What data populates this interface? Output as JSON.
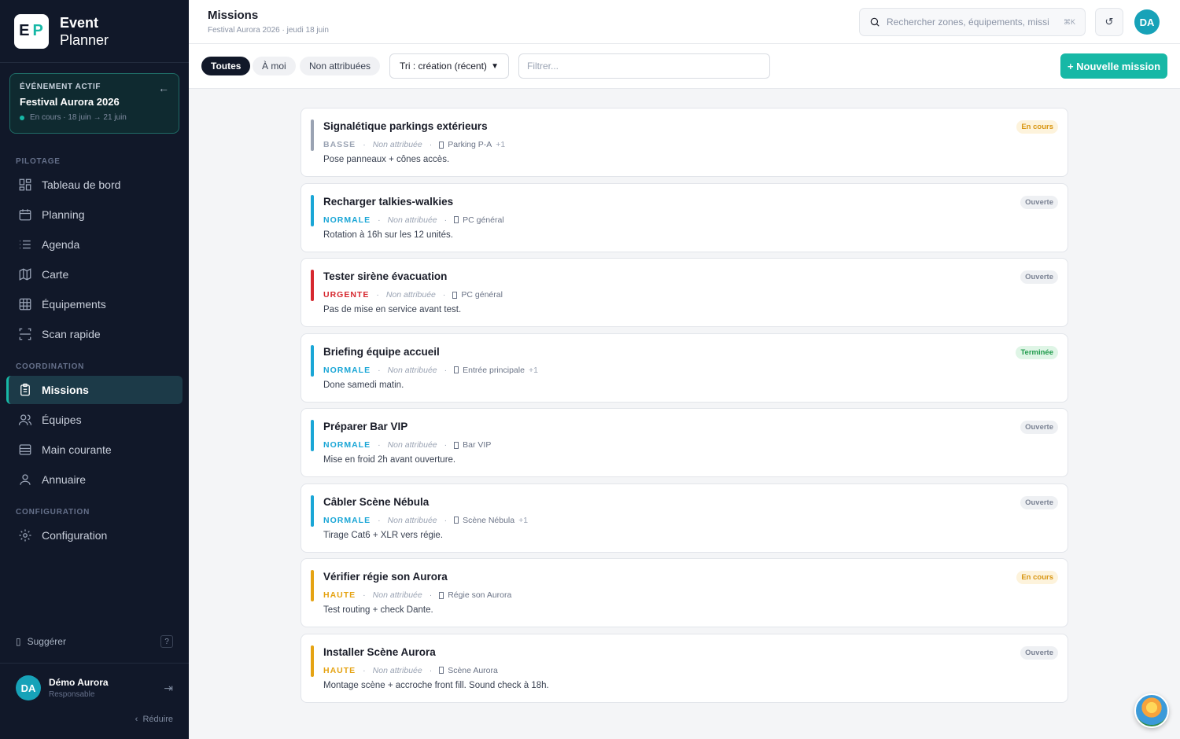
{
  "brand": {
    "initial_e": "E",
    "initial_p": "P",
    "line1": "Event",
    "line2": "Planner"
  },
  "event": {
    "label": "ÉVÉNEMENT ACTIF",
    "name": "Festival Aurora 2026",
    "status": "En cours",
    "dates": "· 18 juin → 21 juin",
    "back_icon": "arrow-left-icon"
  },
  "nav": {
    "section_pilotage": "PILOTAGE",
    "section_coordination": "COORDINATION",
    "section_configuration": "CONFIGURATION",
    "items": [
      {
        "label": "Tableau de bord",
        "icon": "dashboard-icon"
      },
      {
        "label": "Planning",
        "icon": "calendar-icon"
      },
      {
        "label": "Agenda",
        "icon": "list-icon"
      },
      {
        "label": "Carte",
        "icon": "map-icon"
      },
      {
        "label": "Équipements",
        "icon": "grid-icon"
      },
      {
        "label": "Scan rapide",
        "icon": "scan-icon"
      },
      {
        "label": "Missions",
        "icon": "clipboard-icon",
        "active": true
      },
      {
        "label": "Équipes",
        "icon": "users-icon"
      },
      {
        "label": "Main courante",
        "icon": "logbook-icon"
      },
      {
        "label": "Annuaire",
        "icon": "contacts-icon"
      },
      {
        "label": "Configuration",
        "icon": "gear-icon"
      }
    ]
  },
  "footer": {
    "suggest": "Suggérer",
    "help": "?",
    "user_initials": "DA",
    "user_name": "Démo Aurora",
    "user_role": "Responsable",
    "collapse": "Réduire"
  },
  "header": {
    "title": "Missions",
    "subtitle": "Festival Aurora 2026 · jeudi 18 juin",
    "search_placeholder": "Rechercher zones, équipements, missi",
    "search_shortcut": "⌘K",
    "refresh": "↺",
    "avatar": "DA"
  },
  "toolbar": {
    "filters": [
      "Toutes",
      "À moi",
      "Non attribuées"
    ],
    "active_filter": "Toutes",
    "sort": "Tri : création (récent)",
    "filter_placeholder": "Filtrer...",
    "new_button": "+ Nouvelle mission"
  },
  "colors": {
    "accent": "#17b8a6",
    "basse": "#9aa3b3",
    "normale": "#1aa6d6",
    "urgente": "#d6282f",
    "haute": "#e5a313"
  },
  "missions": [
    {
      "title": "Signalétique parkings extérieurs",
      "priority": "BASSE",
      "prio_color": "#9aa3b3",
      "assignee": "Non attribuée",
      "zone": "Parking P-A",
      "extra": "+1",
      "desc": "Pose panneaux + cônes accès.",
      "status": "En cours",
      "status_fg": "#d89510",
      "status_bg": "#fdf3dc"
    },
    {
      "title": "Recharger talkies-walkies",
      "priority": "NORMALE",
      "prio_color": "#1aa6d6",
      "assignee": "Non attribuée",
      "zone": "PC général",
      "extra": "",
      "desc": "Rotation à 16h sur les 12 unités.",
      "status": "Ouverte",
      "status_fg": "#7a8293",
      "status_bg": "#eef0f3"
    },
    {
      "title": "Tester sirène évacuation",
      "priority": "URGENTE",
      "prio_color": "#d6282f",
      "assignee": "Non attribuée",
      "zone": "PC général",
      "extra": "",
      "desc": "Pas de mise en service avant test.",
      "status": "Ouverte",
      "status_fg": "#7a8293",
      "status_bg": "#eef0f3"
    },
    {
      "title": "Briefing équipe accueil",
      "priority": "NORMALE",
      "prio_color": "#1aa6d6",
      "assignee": "Non attribuée",
      "zone": "Entrée principale",
      "extra": "+1",
      "desc": "Done samedi matin.",
      "status": "Terminée",
      "status_fg": "#1f9a4b",
      "status_bg": "#dff5e6"
    },
    {
      "title": "Préparer Bar VIP",
      "priority": "NORMALE",
      "prio_color": "#1aa6d6",
      "assignee": "Non attribuée",
      "zone": "Bar VIP",
      "extra": "",
      "desc": "Mise en froid 2h avant ouverture.",
      "status": "Ouverte",
      "status_fg": "#7a8293",
      "status_bg": "#eef0f3"
    },
    {
      "title": "Câbler Scène Nébula",
      "priority": "NORMALE",
      "prio_color": "#1aa6d6",
      "assignee": "Non attribuée",
      "zone": "Scène Nébula",
      "extra": "+1",
      "desc": "Tirage Cat6 + XLR vers régie.",
      "status": "Ouverte",
      "status_fg": "#7a8293",
      "status_bg": "#eef0f3"
    },
    {
      "title": "Vérifier régie son Aurora",
      "priority": "HAUTE",
      "prio_color": "#e5a313",
      "assignee": "Non attribuée",
      "zone": "Régie son Aurora",
      "extra": "",
      "desc": "Test routing + check Dante.",
      "status": "En cours",
      "status_fg": "#d89510",
      "status_bg": "#fdf3dc"
    },
    {
      "title": "Installer Scène Aurora",
      "priority": "HAUTE",
      "prio_color": "#e5a313",
      "assignee": "Non attribuée",
      "zone": "Scène Aurora",
      "extra": "",
      "desc": "Montage scène + accroche front fill. Sound check à 18h.",
      "status": "Ouverte",
      "status_fg": "#7a8293",
      "status_bg": "#eef0f3"
    }
  ]
}
